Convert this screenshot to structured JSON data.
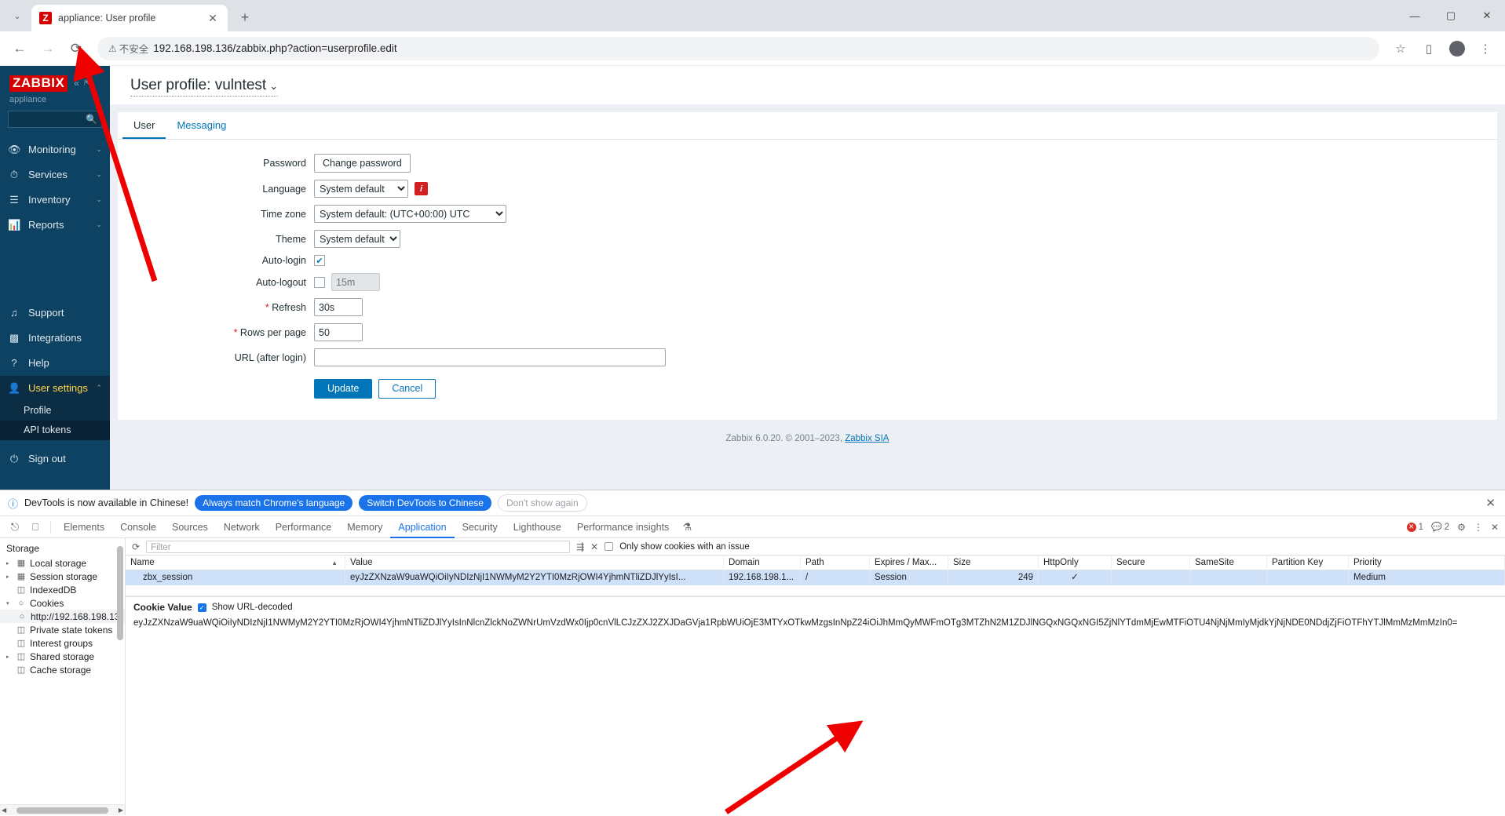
{
  "browser": {
    "tab": {
      "title": "appliance: User profile",
      "favicon_letter": "Z"
    },
    "new_tab_label": "+",
    "window_controls": {
      "minimize": "—",
      "maximize": "▢",
      "close": "✕"
    },
    "toolbar": {
      "back": "←",
      "forward": "→",
      "reload": "⟳",
      "security_label": "不安全",
      "url": "192.168.198.136/zabbix.php?action=userprofile.edit",
      "bookmark": "☆",
      "sidepanel": "▯",
      "profile": "",
      "menu": "⋮"
    }
  },
  "zabbix": {
    "sidebar": {
      "logo": "ZABBIX",
      "subtitle": "appliance",
      "collapse_icon": "«",
      "expand_icon": "⇱",
      "search_placeholder": "",
      "items": [
        {
          "label": "Monitoring",
          "icon": "eye-icon",
          "chevron": "⌄"
        },
        {
          "label": "Services",
          "icon": "stopwatch-icon",
          "chevron": "⌄"
        },
        {
          "label": "Inventory",
          "icon": "list-icon",
          "chevron": "⌄"
        },
        {
          "label": "Reports",
          "icon": "bar-chart-icon",
          "chevron": "⌄"
        }
      ],
      "secondary": [
        {
          "label": "Support",
          "icon": "headset-icon"
        },
        {
          "label": "Integrations",
          "icon": "zabbix-z-icon"
        },
        {
          "label": "Help",
          "icon": "question-icon"
        }
      ],
      "user_settings": {
        "label": "User settings",
        "icon": "user-icon",
        "chevron": "⌃"
      },
      "sub_items": [
        {
          "label": "Profile"
        },
        {
          "label": "API tokens"
        }
      ],
      "sign_out": {
        "label": "Sign out",
        "icon": "power-icon"
      }
    },
    "page_title": "User profile: vulntest",
    "page_title_caret": "⌄",
    "tabs": [
      {
        "label": "User",
        "selected": true
      },
      {
        "label": "Messaging",
        "selected": false
      }
    ],
    "form": {
      "password": {
        "label": "Password",
        "button": "Change password"
      },
      "language": {
        "label": "Language",
        "value": "System default",
        "info_badge": "i"
      },
      "timezone": {
        "label": "Time zone",
        "value": "System default: (UTC+00:00) UTC"
      },
      "theme": {
        "label": "Theme",
        "value": "System default"
      },
      "autologin": {
        "label": "Auto-login",
        "checked": true,
        "check_glyph": "✔"
      },
      "autologout": {
        "label": "Auto-logout",
        "checked": false,
        "placeholder": "15m",
        "value": ""
      },
      "refresh": {
        "label": "Refresh",
        "required": "*",
        "value": "30s"
      },
      "rows_per_page": {
        "label": "Rows per page",
        "required": "*",
        "value": "50"
      },
      "url_after_login": {
        "label": "URL (after login)",
        "value": "",
        "placeholder": ""
      },
      "update_button": "Update",
      "cancel_button": "Cancel"
    },
    "footer": {
      "text": "Zabbix 6.0.20. © 2001–2023, ",
      "link": "Zabbix SIA"
    }
  },
  "devtools": {
    "banner": {
      "info_icon": "ⓘ",
      "text": "DevTools is now available in Chinese!",
      "primary_button": "Always match Chrome's language",
      "secondary_button": "Switch DevTools to Chinese",
      "dismiss_button": "Don't show again",
      "close": "✕"
    },
    "tabs": [
      {
        "label": "Elements",
        "active": false
      },
      {
        "label": "Console",
        "active": false
      },
      {
        "label": "Sources",
        "active": false
      },
      {
        "label": "Network",
        "active": false
      },
      {
        "label": "Performance",
        "active": false
      },
      {
        "label": "Memory",
        "active": false
      },
      {
        "label": "Application",
        "active": true
      },
      {
        "label": "Security",
        "active": false
      },
      {
        "label": "Lighthouse",
        "active": false
      },
      {
        "label": "Performance insights",
        "active": false
      }
    ],
    "status": {
      "errors": "1",
      "warnings": "2",
      "settings_icon": "⚙",
      "more_icon": "⋮",
      "close_icon": "✕"
    },
    "storage_tree": {
      "title": "Storage",
      "items": [
        {
          "label": "Local storage",
          "expandable": true,
          "icon": "table-icon",
          "indent": 0
        },
        {
          "label": "Session storage",
          "expandable": true,
          "icon": "table-icon",
          "indent": 0
        },
        {
          "label": "IndexedDB",
          "expandable": false,
          "icon": "database-icon",
          "indent": 0
        },
        {
          "label": "Cookies",
          "expandable": true,
          "expanded": true,
          "icon": "cookie-icon",
          "indent": 0
        },
        {
          "label": "http://192.168.198.13",
          "expandable": false,
          "icon": "cookie-icon",
          "indent": 1,
          "selected": true
        },
        {
          "label": "Private state tokens",
          "expandable": false,
          "icon": "database-icon",
          "indent": 0
        },
        {
          "label": "Interest groups",
          "expandable": false,
          "icon": "database-icon",
          "indent": 0
        },
        {
          "label": "Shared storage",
          "expandable": true,
          "icon": "database-icon",
          "indent": 0
        },
        {
          "label": "Cache storage",
          "expandable": false,
          "icon": "database-icon",
          "indent": 0
        }
      ]
    },
    "cookie_toolbar": {
      "refresh_icon": "⟳",
      "filter_placeholder": "Filter",
      "clear_filter_icon": "⇶",
      "clear_all_icon": "✕",
      "issues_checkbox_label": "Only show cookies with an issue"
    },
    "cookie_table": {
      "columns": [
        "Name",
        "Value",
        "Domain",
        "Path",
        "Expires / Max...",
        "Size",
        "HttpOnly",
        "Secure",
        "SameSite",
        "Partition Key",
        "Priority"
      ],
      "sorted_column": "Name",
      "sort_arrow": "▲",
      "rows": [
        {
          "Name": "zbx_session",
          "Value": "eyJzZXNzaW9uaWQiOiIyNDIzNjI1NWMyM2Y2YTI0MzRjOWI4YjhmNTliZDJlYyIsI...",
          "Domain": "192.168.198.1...",
          "Path": "/",
          "Expires / Max...": "Session",
          "Size": "249",
          "HttpOnly": "✓",
          "Secure": "",
          "SameSite": "",
          "Partition Key": "",
          "Priority": "Medium"
        }
      ]
    },
    "cookie_value_pane": {
      "title": "Cookie Value",
      "show_url_decoded_label": "Show URL-decoded",
      "show_url_decoded_checked": true,
      "check_glyph": "✓",
      "value": "eyJzZXNzaW9uaWQiOiIyNDIzNjI1NWMyM2Y2YTI0MzRjOWI4YjhmNTliZDJlYyIsInNlcnZlckNoZWNrUmVzdWx0Ijp0cnVlLCJzZXJ2ZXJDaGVja1RpbWUiOjE3MTYxOTkwMzgsInNpZ24iOiJhMmQyMWFmOTg3MTZhN2M1ZDJlNGQxNGQxNGI5ZjNlYTdmMjEwMTFiOTU4NjNjMmIyMjdkYjNjNDE0NDdjZjFiOTFhYTJlMmMzMmMzIn0="
    }
  }
}
